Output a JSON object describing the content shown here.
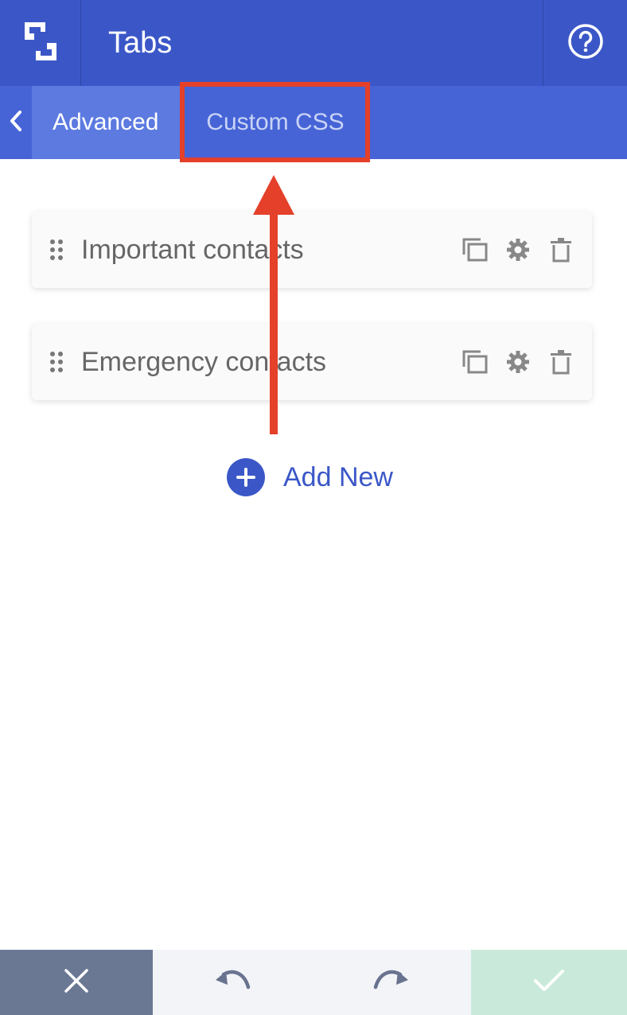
{
  "header": {
    "title": "Tabs",
    "logo_icon": "builder-logo-icon",
    "help_icon": "help-circle-icon",
    "background": "#3b57c7"
  },
  "subnav": {
    "back_icon": "chevron-left-icon",
    "tabs": [
      {
        "label": "Advanced",
        "active": true
      },
      {
        "label": "Custom CSS",
        "active": false,
        "highlighted": true
      }
    ],
    "highlight_color": "#e4402a"
  },
  "items": [
    {
      "label": "Important contacts"
    },
    {
      "label": "Emergency contacts"
    }
  ],
  "item_actions": [
    "duplicate-icon",
    "gear-icon",
    "trash-icon"
  ],
  "add_new": {
    "label": "Add New",
    "icon": "plus-circle-icon"
  },
  "footer": {
    "buttons": [
      {
        "name": "close",
        "icon": "close-icon"
      },
      {
        "name": "undo",
        "icon": "undo-icon"
      },
      {
        "name": "redo",
        "icon": "redo-icon"
      },
      {
        "name": "apply",
        "icon": "check-icon"
      }
    ]
  },
  "colors": {
    "accent": "#3b57c7",
    "annotation": "#e4402a"
  }
}
